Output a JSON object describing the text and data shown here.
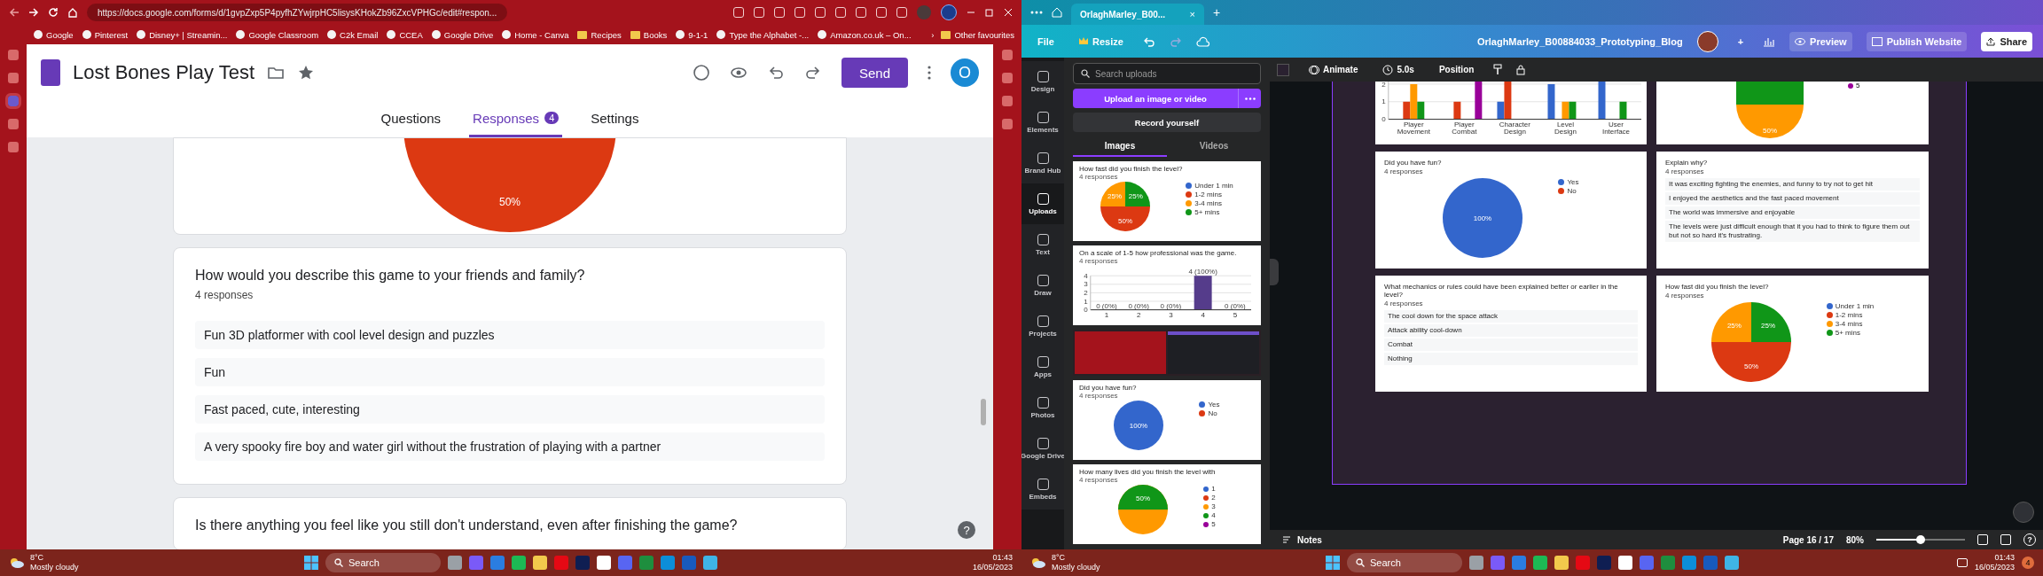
{
  "left_browser": {
    "address": "https://docs.google.com/forms/d/1gvpZxp5P4pyfhZYwjrpHC5lisysKHokZb96ZxcVPHGc/edit#respon...",
    "bookmarks": [
      {
        "label": "Google",
        "kind": "site"
      },
      {
        "label": "Pinterest",
        "kind": "site"
      },
      {
        "label": "Disney+ | Streamin...",
        "kind": "site"
      },
      {
        "label": "Google Classroom",
        "kind": "site"
      },
      {
        "label": "C2k Email",
        "kind": "site"
      },
      {
        "label": "CCEA",
        "kind": "site"
      },
      {
        "label": "Google Drive",
        "kind": "site"
      },
      {
        "label": "Home - Canva",
        "kind": "site"
      },
      {
        "label": "Recipes",
        "kind": "folder"
      },
      {
        "label": "Books",
        "kind": "folder"
      },
      {
        "label": "9-1-1",
        "kind": "site"
      },
      {
        "label": "Type the Alphabet -...",
        "kind": "site"
      },
      {
        "label": "Amazon.co.uk – On...",
        "kind": "site"
      }
    ],
    "more": "›",
    "other_favourites": "Other favourites",
    "form": {
      "title": "Lost Bones Play Test",
      "send": "Send",
      "avatar": "O",
      "tabs": [
        {
          "label": "Questions",
          "selected": false
        },
        {
          "label": "Responses",
          "selected": true,
          "badge": "4"
        },
        {
          "label": "Settings",
          "selected": false
        }
      ],
      "partial_pie_label": "50%",
      "question": {
        "title": "How would you describe this game to your friends and family?",
        "count": "4 responses",
        "answers": [
          "Fun 3D platformer with cool level design and puzzles",
          "Fun",
          "Fast paced, cute, interesting",
          "A very spooky fire boy and water girl without the frustration of playing with a partner"
        ]
      },
      "next_question": "Is there anything you feel like you still don't understand, even after finishing the game?",
      "help": "?"
    }
  },
  "canva": {
    "tab_title": "OrlaghMarley_B00...",
    "tab_close": "×",
    "new_tab": "+",
    "menu": {
      "file": "File",
      "resize": "Resize",
      "doc_title": "OrlaghMarley_B00884033_Prototyping_Blog",
      "add": "+",
      "preview": "Preview",
      "publish": "Publish Website",
      "share": "Share"
    },
    "rail": [
      {
        "label": "Design",
        "selected": false
      },
      {
        "label": "Elements",
        "selected": false
      },
      {
        "label": "Brand Hub",
        "selected": false
      },
      {
        "label": "Uploads",
        "selected": true
      },
      {
        "label": "Text",
        "selected": false
      },
      {
        "label": "Draw",
        "selected": false
      },
      {
        "label": "Projects",
        "selected": false
      },
      {
        "label": "Apps",
        "selected": false
      },
      {
        "label": "Photos",
        "selected": false
      },
      {
        "label": "Google Drive",
        "selected": false
      },
      {
        "label": "Embeds",
        "selected": false
      }
    ],
    "uploads": {
      "search": {
        "placeholder": "Search uploads"
      },
      "upload": "Upload an image or video",
      "record": "Record yourself",
      "tabs": [
        {
          "label": "Images",
          "selected": true
        },
        {
          "label": "Videos",
          "selected": false
        }
      ],
      "thumbnails": [
        {
          "kind": "chart",
          "title": "How fast did you finish the level?",
          "subtitle": "4 responses",
          "chart_data": {
            "type": "pie",
            "categories": [
              "Under 1 min",
              "1-2 mins",
              "3-4 mins",
              "5+ mins"
            ],
            "colors": [
              "#3366cc",
              "#dc3912",
              "#ff9900",
              "#109618"
            ],
            "values": [
              0,
              50,
              25,
              25
            ],
            "value_labels": [
              null,
              "50%",
              "25%",
              "25%"
            ],
            "legend": "right"
          }
        },
        {
          "kind": "chart",
          "title": "On a scale of 1-5 how professional was the game.",
          "subtitle": "4 responses",
          "chart_data": {
            "type": "bar",
            "categories": [
              "1",
              "2",
              "3",
              "4",
              "5"
            ],
            "series": [
              {
                "color": "#553c8b",
                "values": [
                  0,
                  0,
                  0,
                  4,
                  0
                ]
              }
            ],
            "ylim": [
              0,
              4
            ],
            "yticks": [
              0,
              1,
              2,
              3,
              4
            ],
            "grid": true,
            "value_labels": [
              "0 (0%)",
              "0 (0%)",
              "0 (0%)",
              "4 (100%)",
              "0 (0%)"
            ]
          }
        },
        {
          "kind": "screenshot"
        },
        {
          "kind": "chart",
          "title": "Did you have fun?",
          "subtitle": "4 responses",
          "chart_data": {
            "type": "pie",
            "categories": [
              "Yes",
              "No"
            ],
            "colors": [
              "#3366cc",
              "#dc3912"
            ],
            "values": [
              100,
              0
            ],
            "value_labels": [
              "100%",
              null
            ],
            "legend": "right"
          }
        },
        {
          "kind": "lives",
          "title": "How many lives did you finish the level with",
          "subtitle": "4 responses",
          "label": "50%",
          "legend": [
            {
              "label": "1",
              "color": "#3366cc"
            },
            {
              "label": "2",
              "color": "#dc3912"
            },
            {
              "label": "3",
              "color": "#ff9900"
            },
            {
              "label": "4",
              "color": "#109618"
            },
            {
              "label": "5",
              "color": "#990099"
            }
          ]
        }
      ]
    },
    "toolbar": {
      "animate": "Animate",
      "duration": "5.0s",
      "position": "Position"
    },
    "page": {
      "top_bar_chart": {
        "chart_data": {
          "type": "bar",
          "categories": [
            "Player Movement",
            "Player Combat",
            "Character Design",
            "Level Design",
            "User Interface"
          ],
          "series": [
            {
              "color": "#3366cc",
              "values": [
                0,
                0,
                1,
                2,
                2.3
              ]
            },
            {
              "color": "#dc3912",
              "values": [
                1,
                1,
                2.3,
                0,
                0
              ]
            },
            {
              "color": "#ff9900",
              "values": [
                2,
                0,
                0,
                1,
                0
              ]
            },
            {
              "color": "#109618",
              "values": [
                1,
                0,
                0,
                1,
                1
              ]
            },
            {
              "color": "#990099",
              "values": [
                0,
                2.3,
                0,
                0,
                0
              ]
            }
          ],
          "ylim": [
            0,
            2.3
          ],
          "yticks": [
            0,
            1,
            2
          ],
          "grid": true
        }
      },
      "top_pie": {
        "label": "50%",
        "legend": "5"
      },
      "fun_card": {
        "title": "Did you have fun?",
        "subtitle": "4 responses",
        "chart_data": {
          "type": "pie",
          "categories": [
            "Yes",
            "No"
          ],
          "colors": [
            "#3366cc",
            "#dc3912"
          ],
          "values": [
            100,
            0
          ],
          "value_labels": [
            "100%",
            null
          ],
          "legend": "right"
        }
      },
      "explain_card": {
        "title": "Explain why?",
        "subtitle": "4 responses",
        "answers": [
          "It was exciting fighting the enemies, and funny to try not to get hit",
          "I enjoyed the aesthetics and the fast paced movement",
          "The world was immersive and enjoyable",
          "The levels were just difficult enough that it you had to think to figure them out but not so hard it's frustrating."
        ]
      },
      "mechanics_card": {
        "title": "What mechanics or rules could have been explained better or earlier in the level?",
        "subtitle": "4 responses",
        "answers": [
          "The cool down for the space attack",
          "Attack ability cool-down",
          "Combat",
          "Nothing"
        ]
      },
      "fast_card": {
        "title": "How fast did you finish the level?",
        "subtitle": "4 responses",
        "chart_data": {
          "type": "pie",
          "categories": [
            "Under 1 min",
            "1-2 mins",
            "3-4 mins",
            "5+ mins"
          ],
          "colors": [
            "#3366cc",
            "#dc3912",
            "#ff9900",
            "#109618"
          ],
          "values": [
            0,
            50,
            25,
            25
          ],
          "value_labels": [
            null,
            "50%",
            "25%",
            "25%"
          ],
          "legend": "right"
        }
      }
    },
    "bottom": {
      "notes": "Notes",
      "page": "Page 16 / 17",
      "zoom": "80%",
      "zoom_slider": {
        "level": 0.5
      },
      "help": "?"
    }
  },
  "taskbars": [
    {
      "temp": "8°C",
      "weather": "Mostly cloudy",
      "search": "Search",
      "time": "01:43",
      "date": "16/05/2023"
    },
    {
      "temp": "8°C",
      "weather": "Mostly cloudy",
      "search": "Search",
      "time": "01:43",
      "date": "16/05/2023",
      "badge": "4"
    }
  ]
}
